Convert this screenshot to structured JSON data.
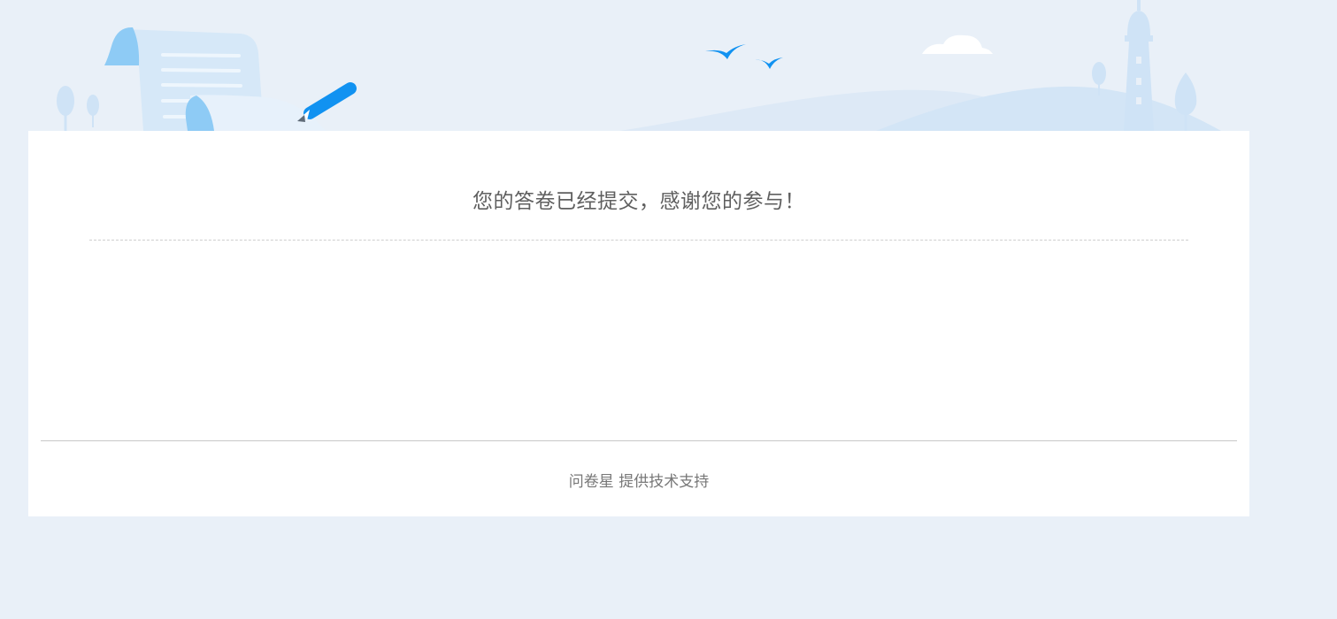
{
  "page": {
    "background_color": "#e9f0f8",
    "card_color": "#ffffff",
    "accent_color": "#1192f1"
  },
  "message": {
    "thanks_text": "您的答卷已经提交，感谢您的参与！"
  },
  "footer": {
    "brand_label": "问卷星",
    "support_text": "提供技术支持"
  },
  "illustration": {
    "icons": [
      "scroll-document-icon",
      "pen-icon",
      "bird-icon",
      "cloud-icon",
      "lighthouse-icon",
      "tree-icon"
    ]
  }
}
